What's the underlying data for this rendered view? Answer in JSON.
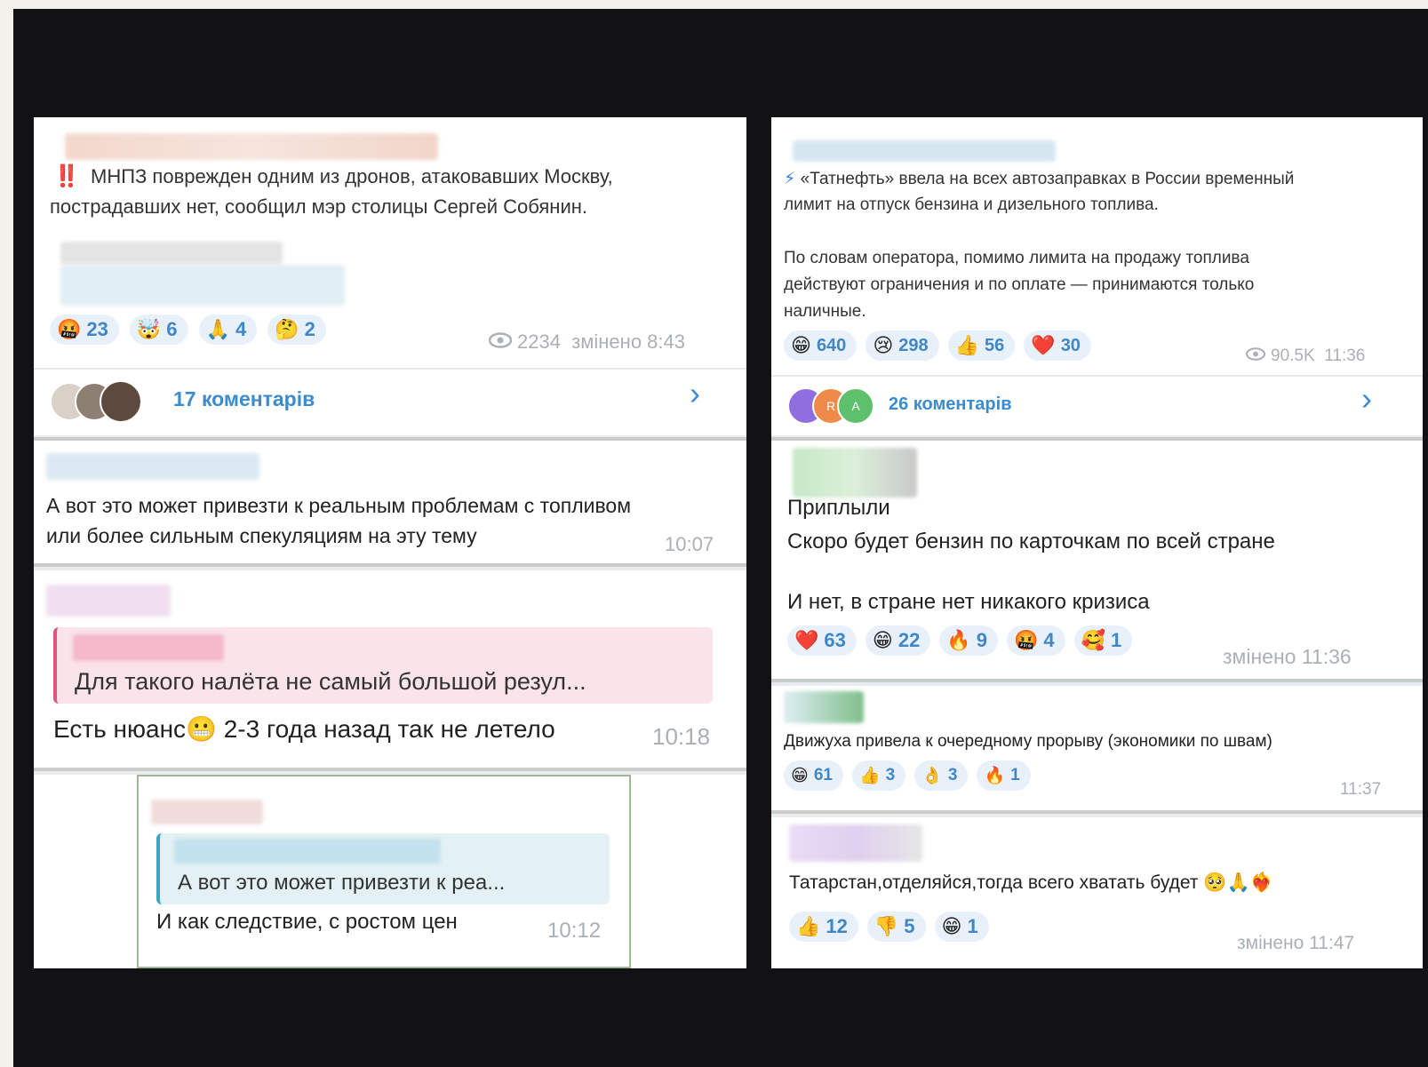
{
  "left": {
    "post": {
      "alert": "‼️",
      "text_line1": "МНПЗ поврежден одним из дронов, атаковавших Москву,",
      "text_line2": "пострадавших нет, сообщил мэр столицы Сергей Собянин.",
      "reactions": [
        {
          "icon": "🤬",
          "count": "23"
        },
        {
          "icon": "🤯",
          "count": "6"
        },
        {
          "icon": "🙏",
          "count": "4"
        },
        {
          "icon": "🤔",
          "count": "2"
        }
      ],
      "views": "2234",
      "meta": "змінено 8:43",
      "comments_label": "17 коментарів"
    },
    "comment1": {
      "line1": "А вот это может привезти к реальным проблемам с топливом",
      "line2": "или более сильным спекуляциям на эту тему",
      "time": "10:07"
    },
    "comment2": {
      "quote": "Для такого налёта не самый большой резул...",
      "text_a": "Есть нюанс",
      "emoji": "😬",
      "text_b": "2-3 года назад так не летело",
      "time": "10:18"
    },
    "comment3": {
      "quote": "А вот это может привезти к реа...",
      "text": "И как следствие, с ростом цен",
      "time": "10:12"
    }
  },
  "right": {
    "post": {
      "icon": "⚡",
      "line1": "«Татнефть» ввела на всех автозаправках в России временный",
      "line2": "лимит на отпуск бензина и дизельного топлива.",
      "line3": "По словам оператора, помимо лимита на продажу топлива",
      "line4": "действуют ограничения и по оплате — принимаются только",
      "line5": "наличные.",
      "reactions": [
        {
          "icon": "😁",
          "count": "640"
        },
        {
          "icon": "😢",
          "count": "298"
        },
        {
          "icon": "👍",
          "count": "56"
        },
        {
          "icon": "❤️",
          "count": "30"
        }
      ],
      "views": "90.5K",
      "time": "11:36",
      "avatars": [
        "",
        "R",
        "A"
      ],
      "comments_label": "26 коментарів"
    },
    "comment1": {
      "name": "Приплыли",
      "line1": "Скоро будет бензин по карточкам по всей стране",
      "line2": "И нет, в стране нет никакого кризиса",
      "reactions": [
        {
          "icon": "❤️",
          "count": "63"
        },
        {
          "icon": "😁",
          "count": "22"
        },
        {
          "icon": "🔥",
          "count": "9"
        },
        {
          "icon": "🤬",
          "count": "4"
        },
        {
          "icon": "🥰",
          "count": "1"
        }
      ],
      "meta": "змінено 11:36"
    },
    "comment2": {
      "text": "Движуха привела к очередному прорыву (экономики по швам)",
      "reactions": [
        {
          "icon": "😁",
          "count": "61"
        },
        {
          "icon": "👍",
          "count": "3"
        },
        {
          "icon": "👌",
          "count": "3"
        },
        {
          "icon": "🔥",
          "count": "1"
        }
      ],
      "time": "11:37"
    },
    "comment3": {
      "text": "Татарстан,отделяйся,тогда всего хватать будет",
      "emojis": "🥺🙏❤️‍🔥",
      "reactions": [
        {
          "icon": "👍",
          "count": "12"
        },
        {
          "icon": "👎",
          "count": "5"
        },
        {
          "icon": "😁",
          "count": "1"
        }
      ],
      "meta": "змінено 11:47"
    }
  },
  "colors": {
    "link": "#3a8bd0",
    "reaction_bg": "#e8f1fa",
    "reaction_text": "#3f87c5",
    "meta": "#a9b0b6",
    "quote_pink": "#e0557f",
    "quote_teal": "#3aa6c0"
  }
}
